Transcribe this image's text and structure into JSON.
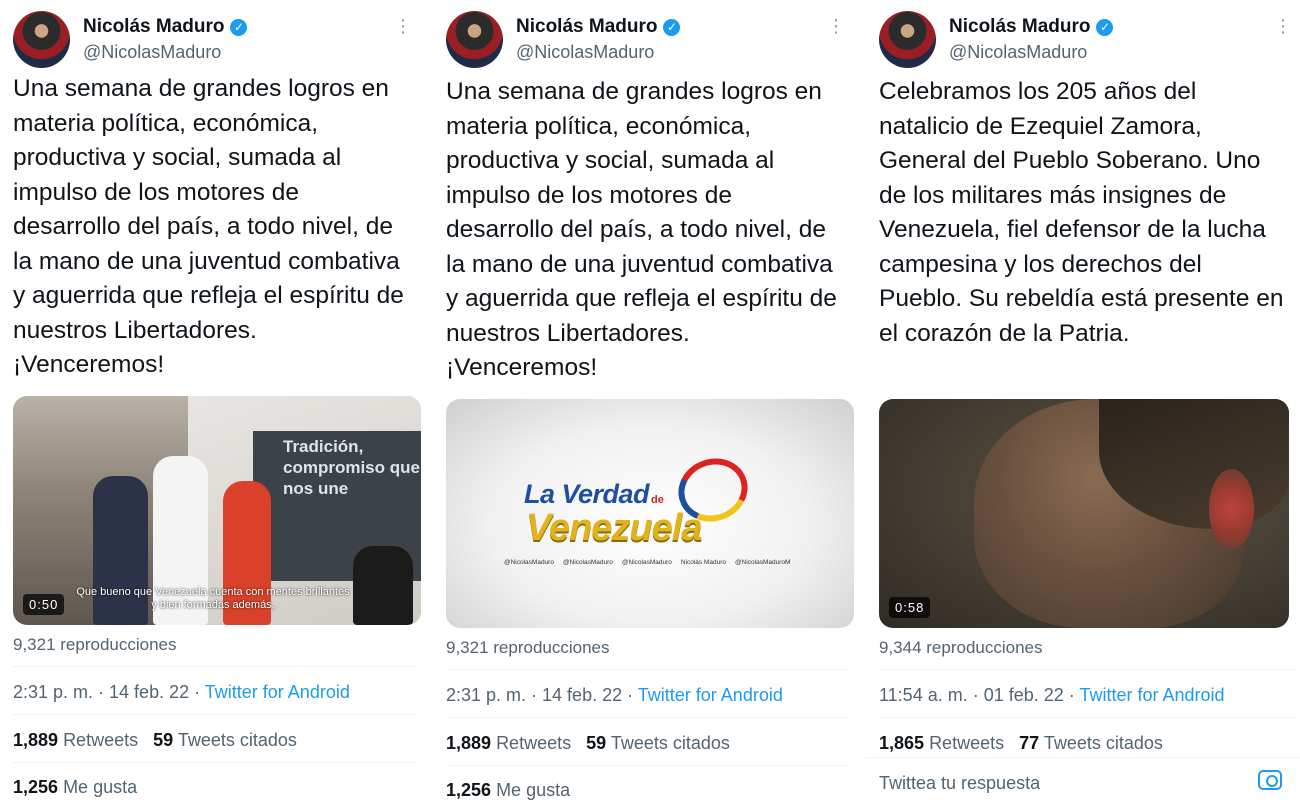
{
  "tweets": [
    {
      "author": "Nicolás Maduro",
      "handle": "@NicolasMaduro",
      "text": "Una semana de grandes logros en materia política, económica, productiva y social, sumada al impulso de los motores de desarrollo del país, a todo nivel, de la mano de una juventud combativa y aguerrida que refleja el espíritu de nuestros Libertadores. ¡Venceremos!",
      "media": {
        "duration": "0:50",
        "sign_text": "Tradición, compromiso que nos une",
        "subtitle": "Que bueno que Venezuela cuenta con mentes brillantes y bien formadas además,"
      },
      "views": "9,321 reproducciones",
      "time": "2:31 p. m. · 14 feb. 22 · ",
      "source": "Twitter for Android",
      "retweets": "1,889",
      "retweets_label": "Retweets",
      "quotes": "59",
      "quotes_label": "Tweets citados",
      "likes": "1,256",
      "likes_label": "Me gusta"
    },
    {
      "author": "Nicolás Maduro",
      "handle": "@NicolasMaduro",
      "text": "Una semana de grandes logros en materia política, económica, productiva y social, sumada al impulso de los motores de desarrollo del país, a todo nivel, de la mano de una juventud combativa y aguerrida que refleja el espíritu de nuestros Libertadores. ¡Venceremos!",
      "media": {
        "logo_top": "La Verdad",
        "logo_de": "de",
        "logo_bottom": "Venezuela",
        "socials": [
          "@NicolasMaduro",
          "@NicolasMaduro",
          "@NicolasMaduro",
          "Nicolás Maduro",
          "@NicolasMaduroM"
        ]
      },
      "views": "9,321 reproducciones",
      "time": "2:31 p. m. · 14 feb. 22 · ",
      "source": "Twitter for Android",
      "retweets": "1,889",
      "retweets_label": "Retweets",
      "quotes": "59",
      "quotes_label": "Tweets citados",
      "likes": "1,256",
      "likes_label": "Me gusta"
    },
    {
      "author": "Nicolás Maduro",
      "handle": "@NicolasMaduro",
      "text": "Celebramos los 205 años del natalicio de Ezequiel Zamora, General del Pueblo Soberano. Uno de los militares más insignes de Venezuela, fiel defensor de la lucha campesina y los derechos del Pueblo. Su rebeldía está presente en el corazón de la Patria.",
      "media": {
        "duration": "0:58"
      },
      "views": "9,344 reproducciones",
      "time": "11:54 a. m. · 01 feb. 22 · ",
      "source": "Twitter for Android",
      "retweets": "1,865",
      "retweets_label": "Retweets",
      "quotes": "77",
      "quotes_label": "Tweets citados",
      "reply_placeholder": "Twittea tu respuesta"
    }
  ],
  "icons": {
    "verified": "verified-badge-icon",
    "more": "more-icon",
    "camera": "camera-icon"
  },
  "colors": {
    "accent": "#1d9bf0",
    "secondary_text": "#536471",
    "primary_text": "#0f1419"
  }
}
